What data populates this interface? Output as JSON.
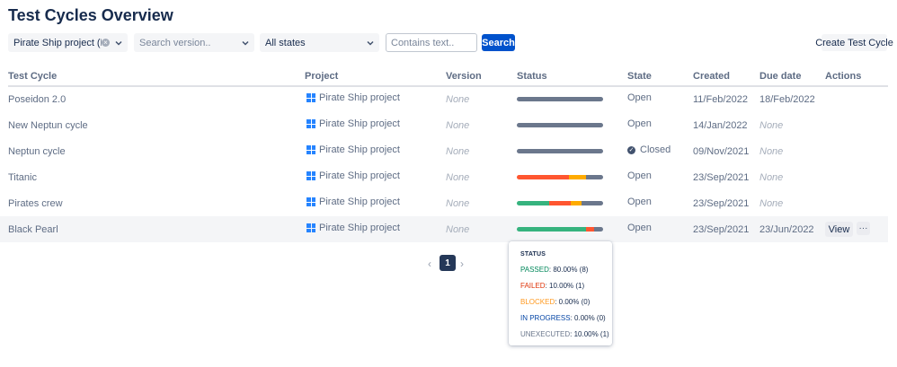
{
  "page": {
    "title": "Test Cycles Overview"
  },
  "filters": {
    "project_value": "Pirate Ship project (PSP)",
    "version_placeholder": "Search version..",
    "state_value": "All states",
    "text_placeholder": "Contains text..",
    "search_label": "Search",
    "create_label": "Create Test Cycle"
  },
  "table": {
    "headers": {
      "cycle": "Test Cycle",
      "project": "Project",
      "version": "Version",
      "status": "Status",
      "state": "State",
      "created": "Created",
      "due": "Due date",
      "actions": "Actions"
    },
    "rows": [
      {
        "name": "Poseidon 2.0",
        "project": "Pirate Ship project",
        "version": "None",
        "state": "Open",
        "created": "11/Feb/2022",
        "due": "18/Feb/2022",
        "status": {
          "passed": 0,
          "failed": 0,
          "blocked": 0,
          "in_progress": 0,
          "unexecuted": 100
        }
      },
      {
        "name": "New Neptun cycle",
        "project": "Pirate Ship project",
        "version": "None",
        "state": "Open",
        "created": "14/Jan/2022",
        "due": "None",
        "status": {
          "passed": 0,
          "failed": 0,
          "blocked": 0,
          "in_progress": 0,
          "unexecuted": 100
        }
      },
      {
        "name": "Neptun cycle",
        "project": "Pirate Ship project",
        "version": "None",
        "state": "Closed",
        "created": "09/Nov/2021",
        "due": "None",
        "status": {
          "passed": 0,
          "failed": 0,
          "blocked": 0,
          "in_progress": 0,
          "unexecuted": 100
        }
      },
      {
        "name": "Titanic",
        "project": "Pirate Ship project",
        "version": "None",
        "state": "Open",
        "created": "23/Sep/2021",
        "due": "None",
        "status": {
          "passed": 0,
          "failed": 60,
          "blocked": 20,
          "in_progress": 0,
          "unexecuted": 20
        }
      },
      {
        "name": "Pirates crew",
        "project": "Pirate Ship project",
        "version": "None",
        "state": "Open",
        "created": "23/Sep/2021",
        "due": "None",
        "status": {
          "passed": 37,
          "failed": 25,
          "blocked": 13,
          "in_progress": 0,
          "unexecuted": 25
        }
      },
      {
        "name": "Black Pearl",
        "project": "Pirate Ship project",
        "version": "None",
        "state": "Open",
        "created": "23/Sep/2021",
        "due": "23/Jun/2022",
        "status": {
          "passed": 80,
          "failed": 10,
          "blocked": 0,
          "in_progress": 0,
          "unexecuted": 10
        }
      }
    ],
    "row_actions": {
      "view_label": "View",
      "more_label": "···"
    }
  },
  "pagination": {
    "prev": "‹",
    "current": "1",
    "next": "›"
  },
  "tooltip": {
    "title": "STATUS",
    "lines": [
      {
        "label": "PASSED",
        "value": ": 80.00% (8)"
      },
      {
        "label": "FAILED",
        "value": ": 10.00% (1)"
      },
      {
        "label": "BLOCKED",
        "value": ": 0.00% (0)"
      },
      {
        "label": "IN PROGRESS",
        "value": ": 0.00% (0)"
      },
      {
        "label": "UNEXECUTED",
        "value": ": 10.00% (1)"
      }
    ]
  },
  "colors": {
    "passed": "#36b37e",
    "failed": "#ff5630",
    "blocked": "#ffab00",
    "in_progress": "#0052cc",
    "unexecuted": "#6b778c",
    "primary": "#0052cc",
    "tip_passed": "#00875a",
    "tip_failed": "#de350b",
    "tip_blocked": "#ff991f",
    "tip_in_progress": "#0747a6",
    "tip_unexecuted": "#6b778c"
  }
}
